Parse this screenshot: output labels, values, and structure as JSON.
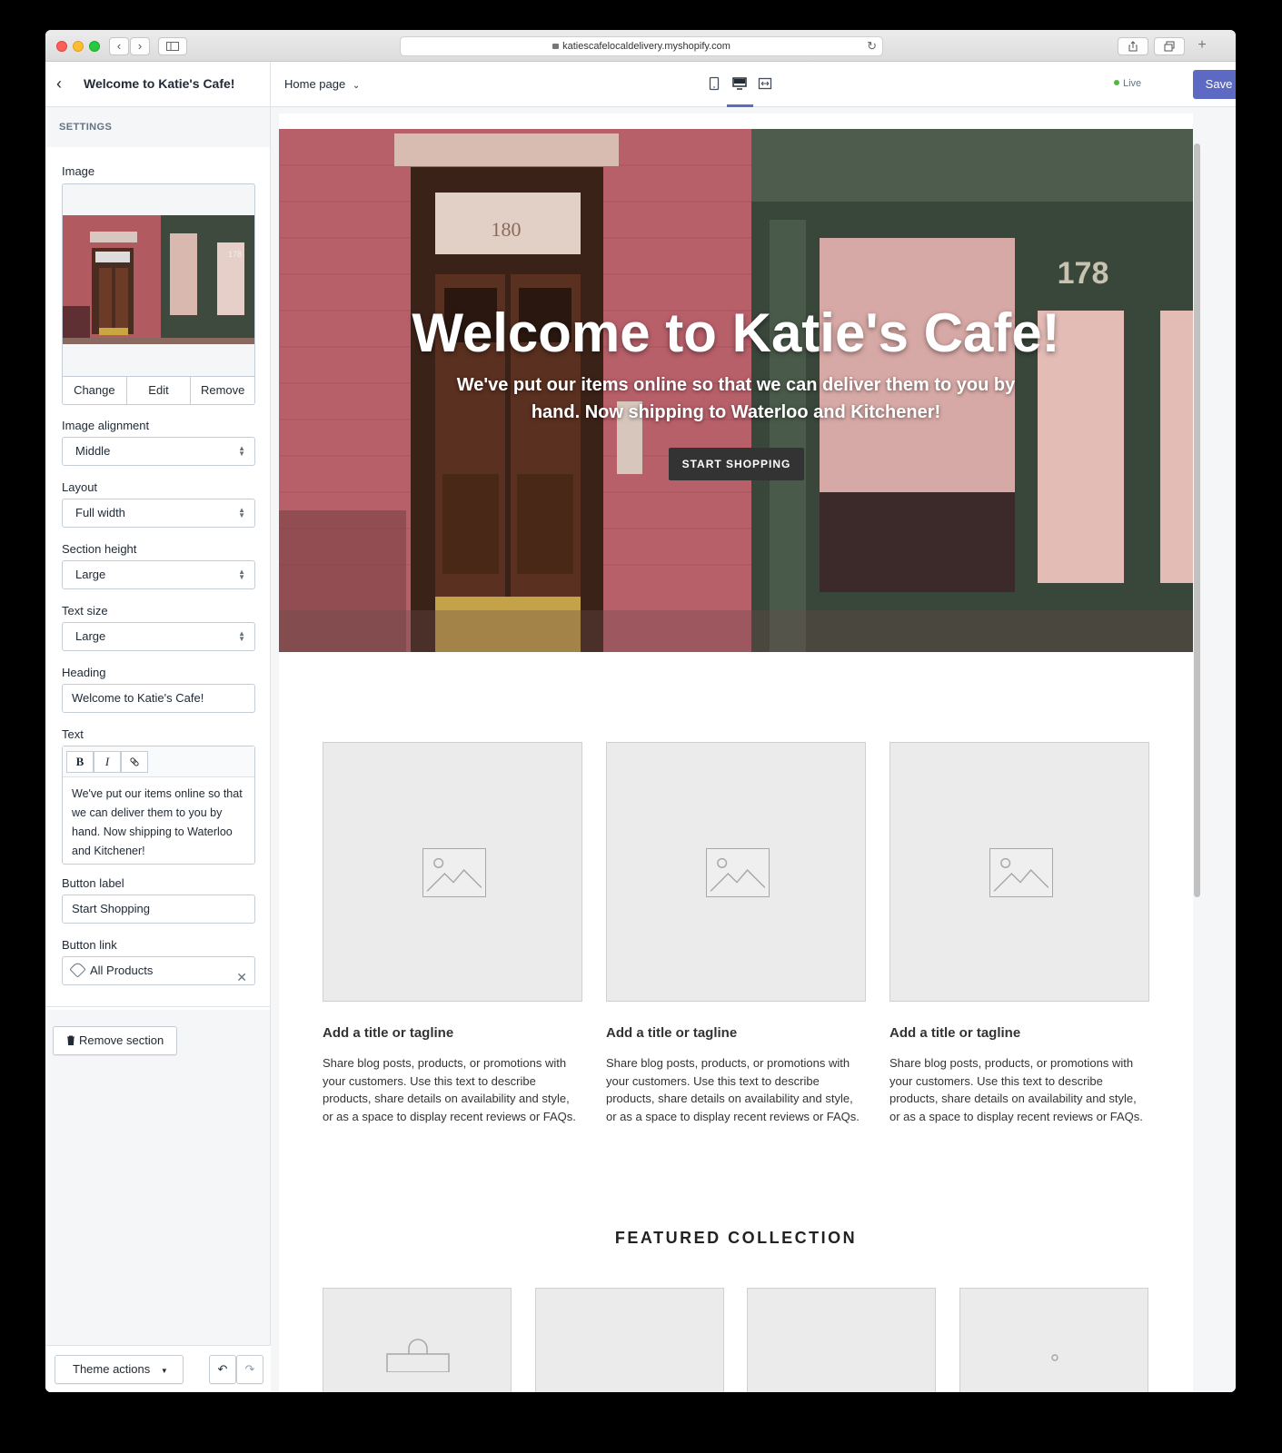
{
  "browser": {
    "url": "katiescafelocaldelivery.myshopify.com"
  },
  "sidebar": {
    "title": "Welcome to Katie's Cafe!",
    "section_label": "SETTINGS",
    "image_label": "Image",
    "image_actions": [
      "Change",
      "Edit",
      "Remove"
    ],
    "image_alignment": {
      "label": "Image alignment",
      "value": "Middle"
    },
    "layout": {
      "label": "Layout",
      "value": "Full width"
    },
    "section_height": {
      "label": "Section height",
      "value": "Large"
    },
    "text_size": {
      "label": "Text size",
      "value": "Large"
    },
    "heading": {
      "label": "Heading",
      "value": "Welcome to Katie's Cafe!"
    },
    "text": {
      "label": "Text",
      "toolbar": [
        "B",
        "I"
      ],
      "value": "We've put our items online so that we can deliver them to you by hand. Now shipping to Waterloo and Kitchener!"
    },
    "button_label": {
      "label": "Button label",
      "value": "Start Shopping"
    },
    "button_link": {
      "label": "Button link",
      "value": "All Products"
    },
    "remove_section": "Remove section",
    "theme_actions": "Theme actions"
  },
  "topbar": {
    "page_select": "Home page",
    "live_label": "Live",
    "save_label": "Save",
    "accent_color": "#5c6ac4",
    "live_color": "#50b83c"
  },
  "preview": {
    "hero": {
      "heading": "Welcome to Katie's Cafe!",
      "text": "We've put our items online so that we can deliver them to you by hand. Now shipping to Waterloo and Kitchener!",
      "button": "START SHOPPING"
    },
    "cards": [
      {
        "title": "Add a title or tagline",
        "text": "Share blog posts, products, or promotions with your customers. Use this text to describe products, share details on availability and style, or as a space to display recent reviews or FAQs."
      },
      {
        "title": "Add a title or tagline",
        "text": "Share blog posts, products, or promotions with your customers. Use this text to describe products, share details on availability and style, or as a space to display recent reviews or FAQs."
      },
      {
        "title": "Add a title or tagline",
        "text": "Share blog posts, products, or promotions with your customers. Use this text to describe products, share details on availability and style, or as a space to display recent reviews or FAQs."
      }
    ],
    "featured_title": "FEATURED COLLECTION"
  }
}
